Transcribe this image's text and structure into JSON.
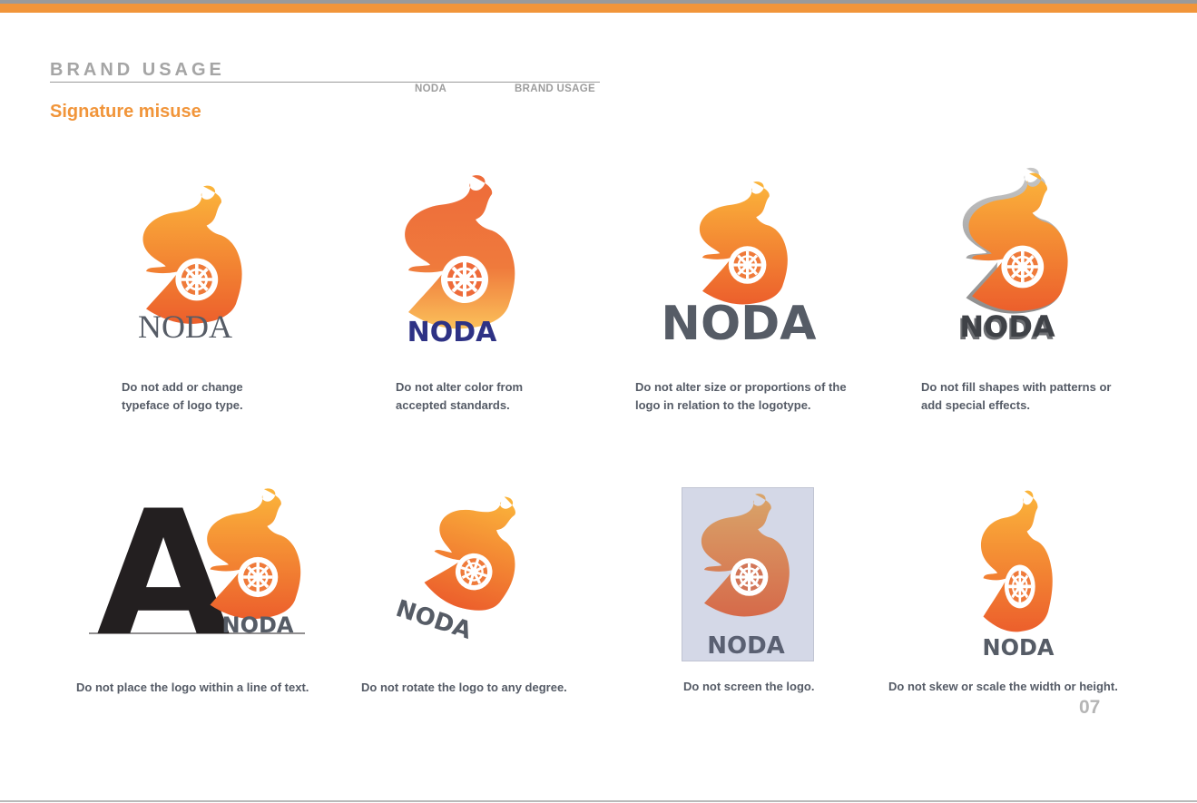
{
  "header": {
    "section_title": "BRAND USAGE",
    "nav": [
      "NODA",
      "BRAND USAGE"
    ],
    "page_heading": "Signature misuse"
  },
  "logo_wordmark": "NODA",
  "big_letter": "A",
  "examples": [
    {
      "caption": "Do not add or change\ntypeface of logo type."
    },
    {
      "caption": "Do not alter color from\naccepted standards."
    },
    {
      "caption": "Do not alter size or proportions of the\nlogo in relation to the logotype."
    },
    {
      "caption": "Do not fill shapes with patterns or\nadd special effects."
    },
    {
      "caption": "Do not place the logo within a line of text."
    },
    {
      "caption": "Do not rotate the logo to any degree."
    },
    {
      "caption": "Do not screen the logo."
    },
    {
      "caption": "Do not skew or scale the width or height."
    }
  ],
  "footer": {
    "page_number": "07"
  },
  "colors": {
    "brand_orange": "#f1953a",
    "flame_yellow": "#fbb53b",
    "flame_red": "#ec5f2c",
    "wordmark_grey": "#565c66",
    "wordmark_navy": "#2e3285",
    "screen_bg": "#d4d8e7"
  },
  "icons": [
    "flame-wheel-logo-icon"
  ]
}
